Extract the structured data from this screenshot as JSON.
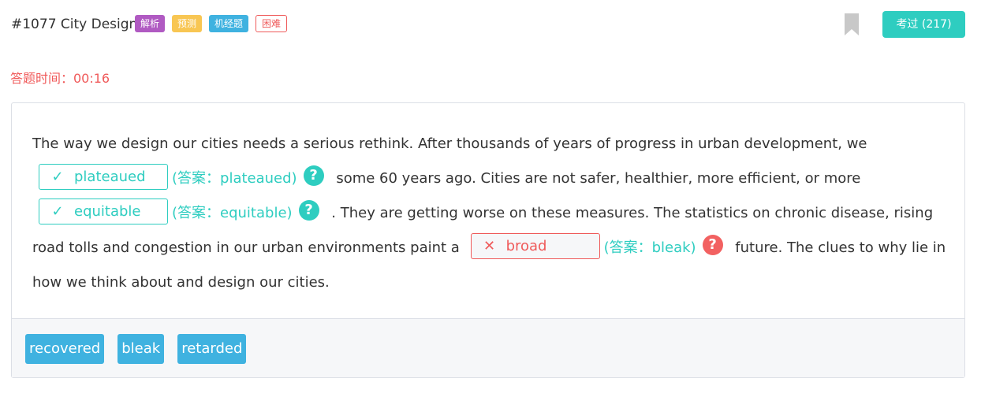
{
  "header": {
    "title": "#1077 City Design",
    "tags": [
      {
        "label": "解析",
        "color": "#b05ac2"
      },
      {
        "label": "预测",
        "color": "#f8c653"
      },
      {
        "label": "机经题",
        "color": "#3fb2e0"
      },
      {
        "label": "困难",
        "color": "#ef5a5a"
      }
    ],
    "exam_button": "考过 (217)",
    "bookmark_icon": "bookmark-icon"
  },
  "timer": "答题时间：00:16",
  "colors": {
    "accent": "#2ecdc0",
    "error": "#f05a5a",
    "option": "#3fb2e0"
  },
  "passage": {
    "seg0": "The way we design our cities needs a serious rethink. After thousands of years of progress in urban development, we",
    "blank1": {
      "mark": "✓",
      "value": "plateaued",
      "answer": "(答案：plateaued)",
      "correct": true
    },
    "seg1": "some 60 years ago. Cities are not safer, healthier, more efficient, or more",
    "blank2": {
      "mark": "✓",
      "value": "equitable",
      "answer": "(答案：equitable)",
      "correct": true
    },
    "seg2": ". They are getting worse on these measures. The statistics on chronic disease, rising road tolls and congestion in our urban environments paint a",
    "blank3": {
      "mark": "✕",
      "value": "broad",
      "answer": "(答案：bleak)",
      "correct": false
    },
    "seg3": "future. The clues to why lie in how we think about and design our cities.",
    "help_glyph": "?"
  },
  "options": [
    "recovered",
    "bleak",
    "retarded"
  ]
}
